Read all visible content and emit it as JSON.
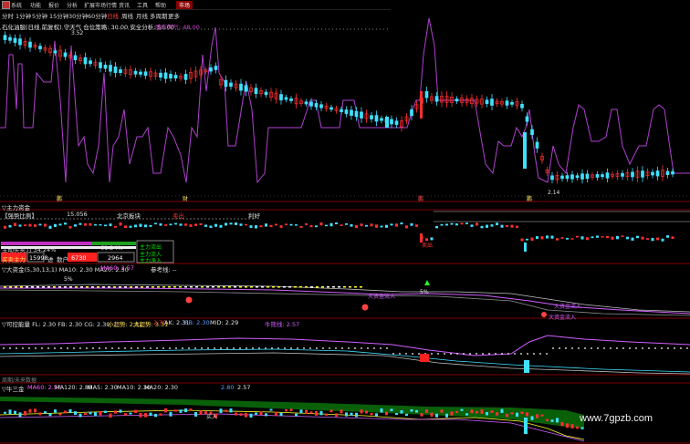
{
  "menu": {
    "items": [
      "系统",
      "功能",
      "报价",
      "分析",
      "扩展市场行情",
      "资讯",
      "工具",
      "帮助"
    ],
    "active": "市场"
  },
  "periods": {
    "items": [
      "分时",
      "1分钟",
      "5分钟",
      "15分钟",
      "30分钟",
      "60分钟",
      "日线",
      "周线",
      "月线",
      "多周期",
      "更多"
    ],
    "active": "日线"
  },
  "panel1": {
    "header_a": "石化油服(日线 前复权) 守天气 仓位策略: 30.00 安全分析: 50.00",
    "header_b": "股市天气: 48.00",
    "price_high": "3.52",
    "price_low": "2.14",
    "footer_labels": [
      "鹏",
      "财",
      "鹏",
      "鹏"
    ]
  },
  "panel2": {
    "title": "▽主力资金",
    "bar_label": "【强势比例】",
    "bar_value": "15.056",
    "bar_region": "北京板块",
    "bar_tag": "卖出",
    "bar_right": "利好",
    "flow_label": "主动买卖力 34.24%",
    "flow_pct": "61.24%",
    "flow_title": "主力流出",
    "buy_label": "买卖主力",
    "buy_val": "15998",
    "dir_label": "进",
    "hold_label": "散户",
    "hold_val": "6730",
    "net_val": "2964",
    "flow_sub": "主力流入",
    "net_in": "主力净入",
    "sell_tag": "卖出"
  },
  "panel3": {
    "title": "▽大资金(5,30,13,1)  MA10: 2.30  MA20: 2.30",
    "ma60": "MA60: 2.57",
    "ref": "参考线: --",
    "pct": "5%",
    "flow_tags": [
      "大资金流入",
      "大资金流入",
      "大资金流入"
    ],
    "arrow_pct": "5%"
  },
  "panel4": {
    "title": "▽可控能量 FL: 2.30  FB: 2.30  CG: 2.30",
    "small": "小超势: 2.31",
    "big": "大超势: 3.31",
    "v1": "2.30",
    "ak": "AK: 2.31",
    "bb": "BB: 2.30",
    "mid": "MID: 2.29",
    "bull": "牛熊线: 2.57"
  },
  "panel5": {
    "title": "周期/未来数据"
  },
  "panel6": {
    "title": "▽牛三金",
    "ma60": "MA60: 2.57",
    "ma120": "MA120: 2.80",
    "ma5": "MA5: 2.30",
    "ma10": "MA10: 2.30",
    "ma20": "MA20: 2.30",
    "x1": "2.80",
    "x2": "2.57",
    "tag": "买入",
    "tag2": "上涨"
  },
  "watermark": "www.7gpzb.com",
  "colors": {
    "up": "#ff3030",
    "down": "#40e0ff",
    "purple": "#b040d0",
    "grid": "#800000",
    "yellow": "#ffff30",
    "green": "#00c000"
  }
}
